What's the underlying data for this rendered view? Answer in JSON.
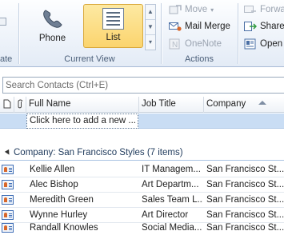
{
  "ribbon": {
    "left_group_label": "ate",
    "current_view": {
      "label": "Current View",
      "buttons": [
        {
          "label": "Phone",
          "icon": "phone-icon",
          "selected": false
        },
        {
          "label": "List",
          "icon": "list-icon",
          "selected": true
        }
      ]
    },
    "actions": {
      "label": "Actions",
      "move": "Move",
      "mail_merge": "Mail Merge",
      "onenote": "OneNote"
    },
    "share": {
      "forward": "Forwa",
      "share": "Share",
      "open": "Open"
    }
  },
  "search": {
    "placeholder": "Search Contacts (Ctrl+E)"
  },
  "grid": {
    "columns": {
      "full_name": "Full Name",
      "job_title": "Job Title",
      "company": "Company"
    },
    "new_row_prompt": "Click here to add a new ...",
    "group": "Company: San Francisco Styles (7 items)",
    "rows": [
      {
        "name": "Kellie Allen",
        "job": "IT Managem...",
        "company": "San Francisco St..."
      },
      {
        "name": "Alec Bishop",
        "job": "Art Departm...",
        "company": "San Francisco St..."
      },
      {
        "name": "Meredith Green",
        "job": "Sales Team L...",
        "company": "San Francisco St..."
      },
      {
        "name": "Wynne Hurley",
        "job": "Art Director",
        "company": "San Francisco St..."
      },
      {
        "name": "Randall Knowles",
        "job": "Social Media...",
        "company": "San Francisco St..."
      }
    ]
  },
  "colors": {
    "selected_view": "#fbd46e",
    "new_row_bg": "#c9ddf4",
    "group_text": "#1e395b",
    "ribbon_label": "#4c607a"
  }
}
